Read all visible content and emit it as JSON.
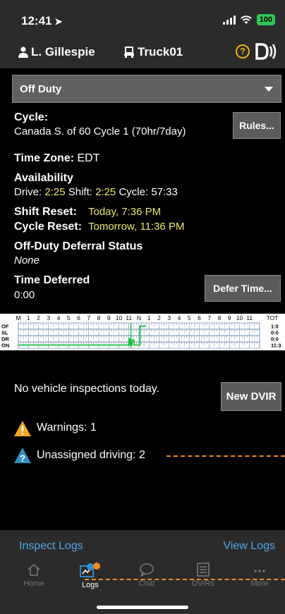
{
  "status_bar": {
    "time": "12:41",
    "battery": "100"
  },
  "driver": {
    "name": "L. Gillespie",
    "truck": "Truck01",
    "help_glyph": "?"
  },
  "duty_status": {
    "selected": "Off Duty"
  },
  "cycle": {
    "label": "Cycle:",
    "value": "Canada S. of 60 Cycle 1 (70hr/7day)",
    "rules_button": "Rules..."
  },
  "time_zone": {
    "label": "Time Zone:",
    "value": "EDT"
  },
  "availability": {
    "label": "Availability",
    "drive_label": "Drive:",
    "drive_value": "2:25",
    "shift_label": "Shift:",
    "shift_value": "2:25",
    "cycle_label": "Cycle:",
    "cycle_value": "57:33"
  },
  "resets": {
    "shift_label": "Shift Reset:",
    "shift_value": "Today, 7:36 PM",
    "cycle_label": "Cycle Reset:",
    "cycle_value": "Tomorrow, 11:36 PM"
  },
  "deferral": {
    "label": "Off-Duty Deferral Status",
    "value": "None"
  },
  "time_deferred": {
    "label": "Time Deferred",
    "value": "0:00",
    "defer_button": "Defer Time..."
  },
  "log_graph": {
    "hours_header": [
      "M",
      "1",
      "2",
      "3",
      "4",
      "5",
      "6",
      "7",
      "8",
      "9",
      "10",
      "11",
      "N",
      "1",
      "2",
      "3",
      "4",
      "5",
      "6",
      "7",
      "8",
      "9",
      "10",
      "11"
    ],
    "total_header": "TOT",
    "rows": [
      {
        "label": "OF",
        "total": "1:0"
      },
      {
        "label": "SL",
        "total": "0:0"
      },
      {
        "label": "DR",
        "total": "0:0"
      },
      {
        "label": "ON",
        "total": "11:3"
      }
    ],
    "line_color": "#16c23a"
  },
  "inspections": {
    "message": "No vehicle inspections today.",
    "new_button": "New DVIR"
  },
  "alerts": {
    "warnings": "Warnings: 1",
    "unassigned": "Unassigned driving: 2",
    "warning_color": "#f5a623",
    "info_color": "#2f8fbf"
  },
  "bottom_links": {
    "inspect": "Inspect Logs",
    "view": "View Logs"
  },
  "tabs": [
    {
      "label": "Home",
      "icon": "home-icon"
    },
    {
      "label": "Logs",
      "icon": "logs-icon"
    },
    {
      "label": "Chat",
      "icon": "chat-icon"
    },
    {
      "label": "DVIRs",
      "icon": "dvirs-icon"
    },
    {
      "label": "More",
      "icon": "more-icon"
    }
  ]
}
